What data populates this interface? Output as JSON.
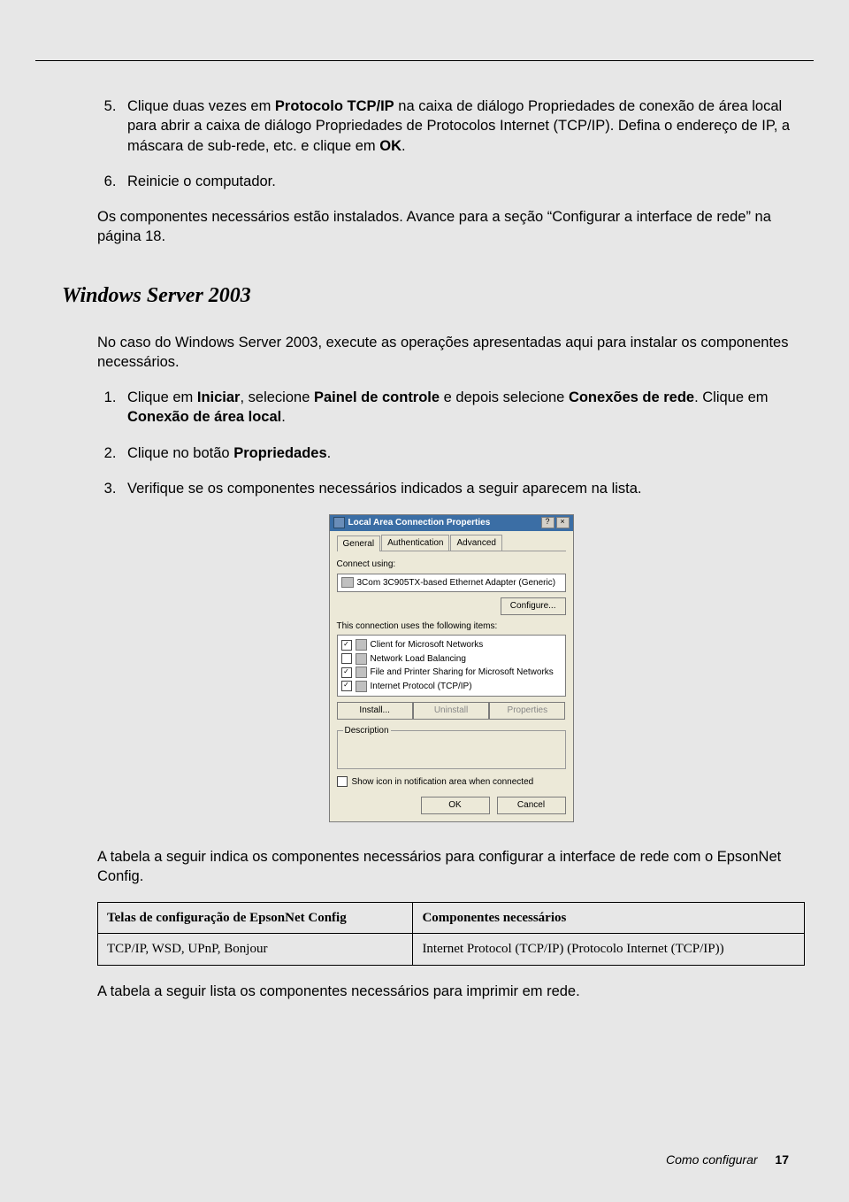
{
  "steps_top": {
    "start": 5,
    "items": [
      {
        "pre": "Clique duas vezes em ",
        "b1": "Protocolo TCP/IP",
        "mid": " na caixa de diálogo Propriedades de conexão de área local para abrir a caixa de diálogo Propriedades de Protocolos Internet (TCP/IP). Defina o endereço de IP, a máscara de sub-rede, etc. e clique em ",
        "b2": "OK",
        "post": "."
      },
      {
        "plain": "Reinicie o computador."
      }
    ]
  },
  "para_after_top": "Os componentes necessários estão instalados. Avance para a seção “Configurar a interface de rede” na página 18.",
  "section_heading": "Windows Server 2003",
  "section_intro": "No caso do Windows Server 2003, execute as operações apresentadas aqui para instalar os componentes necessários.",
  "steps_ws": [
    {
      "parts": [
        {
          "t": "Clique em "
        },
        {
          "b": "Iniciar"
        },
        {
          "t": ", selecione "
        },
        {
          "b": "Painel de controle"
        },
        {
          "t": " e depois selecione "
        },
        {
          "b": "Conexões de rede"
        },
        {
          "t": ". Clique em "
        },
        {
          "b": "Conexão de área local"
        },
        {
          "t": "."
        }
      ]
    },
    {
      "parts": [
        {
          "t": "Clique no botão "
        },
        {
          "b": "Propriedades"
        },
        {
          "t": "."
        }
      ]
    },
    {
      "parts": [
        {
          "t": "Verifique se os componentes necessários indicados a seguir aparecem na lista."
        }
      ]
    }
  ],
  "dialog": {
    "title": "Local Area Connection Properties",
    "tabs": [
      "General",
      "Authentication",
      "Advanced"
    ],
    "connect_using_label": "Connect using:",
    "adapter": "3Com 3C905TX-based Ethernet Adapter (Generic)",
    "configure_btn": "Configure...",
    "items_label": "This connection uses the following items:",
    "items": [
      {
        "checked": true,
        "label": "Client for Microsoft Networks"
      },
      {
        "checked": false,
        "label": "Network Load Balancing"
      },
      {
        "checked": true,
        "label": "File and Printer Sharing for Microsoft Networks"
      },
      {
        "checked": true,
        "label": "Internet Protocol (TCP/IP)"
      }
    ],
    "install_btn": "Install...",
    "uninstall_btn": "Uninstall",
    "properties_btn": "Properties",
    "description_label": "Description",
    "show_icon_label": "Show icon in notification area when connected",
    "ok_btn": "OK",
    "cancel_btn": "Cancel"
  },
  "para_after_dialog": "A tabela a seguir indica os componentes necessários para configurar a interface de rede com o EpsonNet Config.",
  "table1": {
    "headers": [
      "Telas de configuração de EpsonNet Config",
      "Componentes necessários"
    ],
    "rows": [
      [
        "TCP/IP, WSD, UPnP, Bonjour",
        "Internet Protocol (TCP/IP) (Protocolo Internet (TCP/IP))"
      ]
    ]
  },
  "para_after_table1": "A tabela a seguir lista os componentes necessários para imprimir em rede.",
  "footer": {
    "section": "Como configurar",
    "page": "17"
  }
}
